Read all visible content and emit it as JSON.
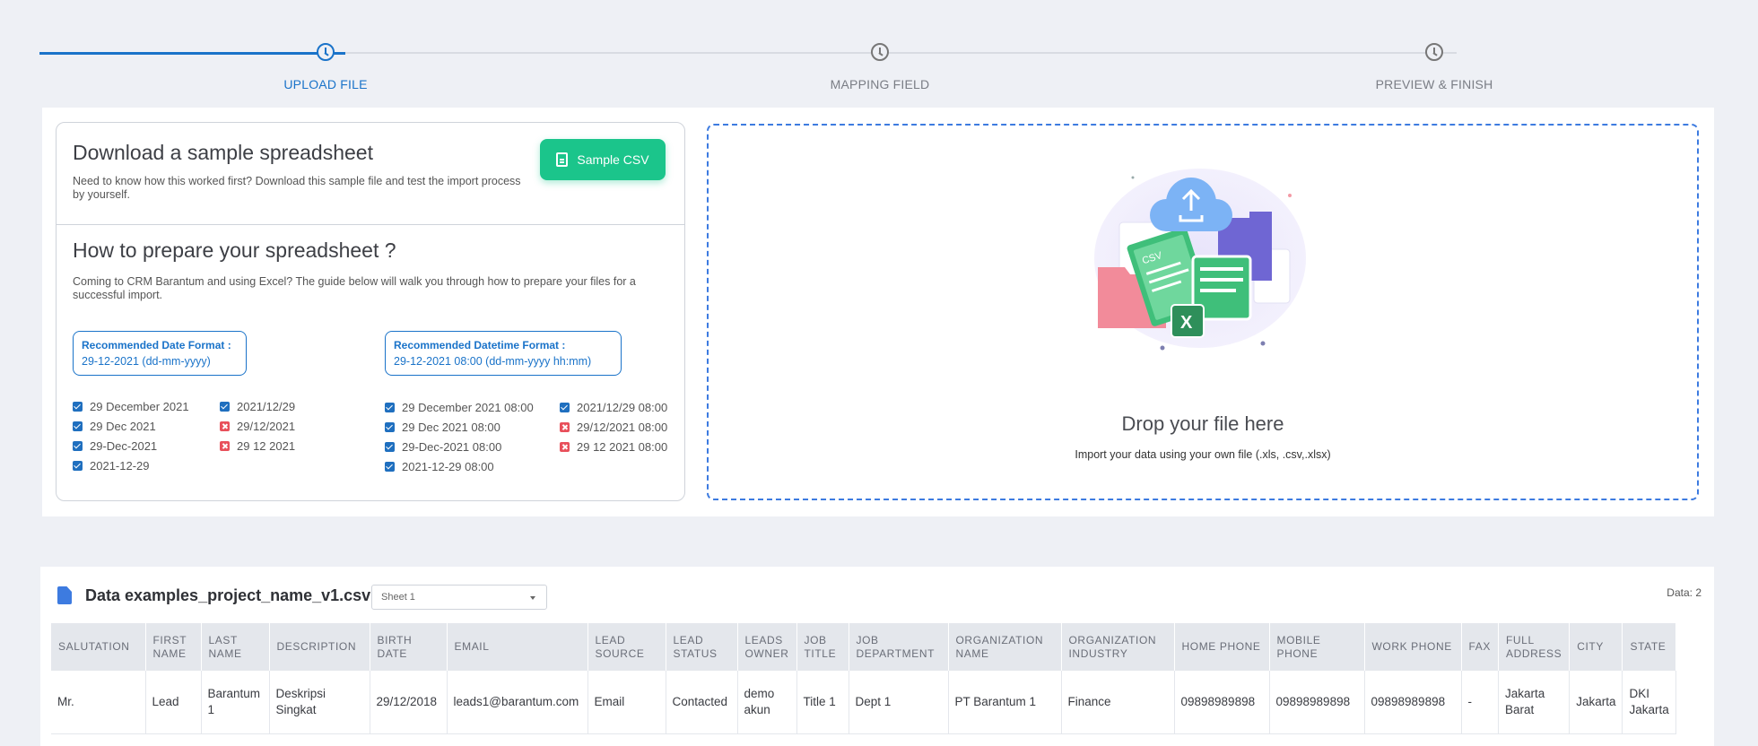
{
  "stepper": {
    "steps": [
      {
        "label": "UPLOAD FILE",
        "active": true
      },
      {
        "label": "MAPPING FIELD",
        "active": false
      },
      {
        "label": "PREVIEW & FINISH",
        "active": false
      }
    ],
    "accent_color": "#1a73c9"
  },
  "sample": {
    "title": "Download a sample spreadsheet",
    "description": "Need to know how this worked first? Download this sample file and test the import process by yourself.",
    "button_label": "Sample CSV",
    "button_icon": "document-icon",
    "button_color": "#1bc58b"
  },
  "guide": {
    "title": "How to prepare your spreadsheet ?",
    "description": "Coming to CRM Barantum and using Excel? The guide below will walk you through how to prepare your files for a successful import.",
    "date_format": {
      "title": "Recommended Date Format :",
      "value": "29-12-2021 (dd-mm-yyyy)"
    },
    "datetime_format": {
      "title": "Recommended Datetime Format :",
      "value": "29-12-2021 08:00 (dd-mm-yyyy hh:mm)"
    },
    "date_examples_col1": [
      {
        "text": "29 December 2021",
        "valid": true
      },
      {
        "text": "29 Dec 2021",
        "valid": true
      },
      {
        "text": "29-Dec-2021",
        "valid": true
      },
      {
        "text": "2021-12-29",
        "valid": true
      }
    ],
    "date_examples_col2": [
      {
        "text": "2021/12/29",
        "valid": true
      },
      {
        "text": "29/12/2021",
        "valid": false
      },
      {
        "text": "29 12 2021",
        "valid": false
      }
    ],
    "datetime_examples_col1": [
      {
        "text": "29 December 2021 08:00",
        "valid": true
      },
      {
        "text": "29 Dec 2021 08:00",
        "valid": true
      },
      {
        "text": "29-Dec-2021 08:00",
        "valid": true
      },
      {
        "text": "2021-12-29 08:00",
        "valid": true
      }
    ],
    "datetime_examples_col2": [
      {
        "text": "2021/12/29 08:00",
        "valid": true
      },
      {
        "text": "29/12/2021 08:00",
        "valid": false
      },
      {
        "text": "29 12 2021 08:00",
        "valid": false
      }
    ]
  },
  "dropzone": {
    "title": "Drop your file here",
    "subtitle": "Import your data using your own file (.xls, .csv,.xlsx)",
    "illustration_label": "CSV",
    "illustration_excel": "X"
  },
  "data_table": {
    "file_name": "Data examples_project_name_v1.csv",
    "sheet": "Sheet 1",
    "count_text": "Data: 2",
    "columns": [
      "SALUTATION",
      "FIRST NAME",
      "LAST NAME",
      "DESCRIPTION",
      "BIRTH DATE",
      "EMAIL",
      "LEAD SOURCE",
      "LEAD STATUS",
      "LEADS OWNER",
      "JOB TITLE",
      "JOB DEPARTMENT",
      "ORGANIZATION NAME",
      "ORGANIZATION INDUSTRY",
      "HOME PHONE",
      "MOBILE PHONE",
      "WORK PHONE",
      "FAX",
      "FULL ADDRESS",
      "CITY",
      "STATE"
    ],
    "rows": [
      [
        "Mr.",
        "Lead",
        "Barantum 1",
        "Deskripsi Singkat",
        "29/12/2018",
        "leads1@barantum.com",
        "Email",
        "Contacted",
        "demo akun",
        "Title 1",
        "Dept 1",
        "PT Barantum 1",
        "Finance",
        "09898989898",
        "09898989898",
        "09898989898",
        "-",
        "Jakarta Barat",
        "Jakarta",
        "DKI Jakarta"
      ]
    ]
  }
}
